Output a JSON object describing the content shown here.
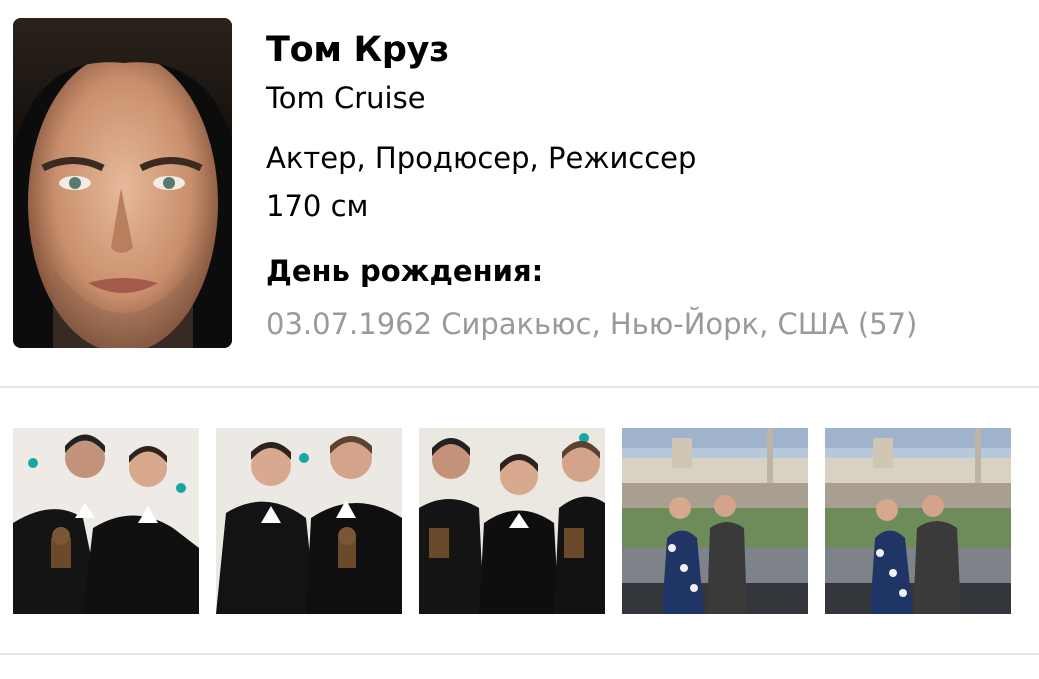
{
  "person": {
    "name_ru": "Том Круз",
    "name_en": "Tom Cruise",
    "professions": "Актер, Продюсер, Режиссер",
    "height": "170 см",
    "birth_label": "День рождения:",
    "birth_value": "03.07.1962 Сиракьюс, Нью-Йорк, США (57)"
  },
  "colors": {
    "secondary_text": "#9a9a9a",
    "divider": "#e6e6e6"
  },
  "gallery": {
    "photos": [
      {
        "icon": "event-photo-icon"
      },
      {
        "icon": "event-photo-icon"
      },
      {
        "icon": "event-photo-icon"
      },
      {
        "icon": "outdoor-photo-icon"
      },
      {
        "icon": "outdoor-photo-icon"
      }
    ]
  }
}
